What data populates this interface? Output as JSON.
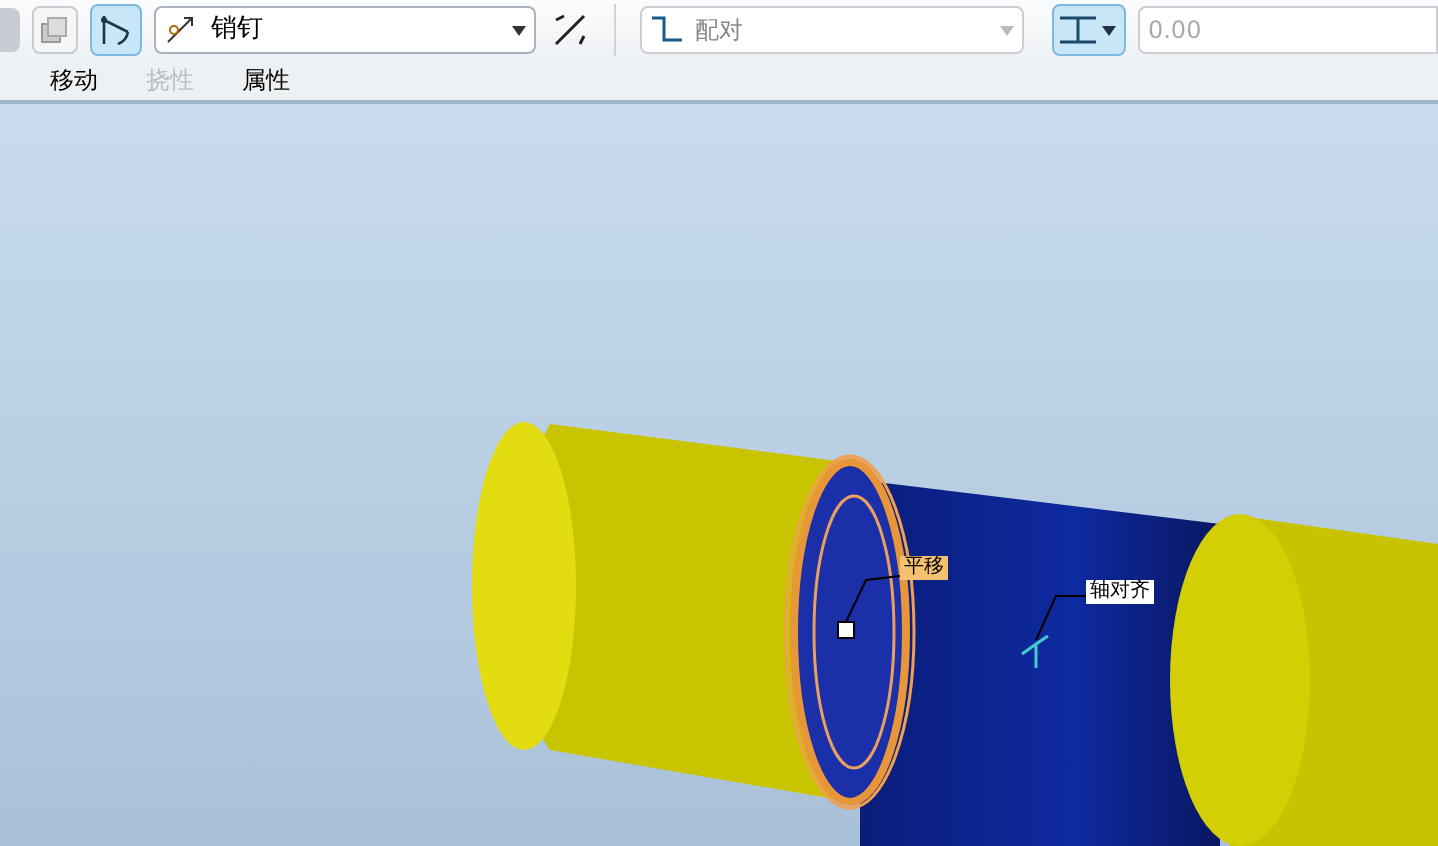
{
  "toolbar": {
    "constraint_type": {
      "value": "销钉"
    },
    "reference_type": {
      "value": "配对",
      "disabled": true
    },
    "offset": {
      "placeholder": "0.00"
    }
  },
  "tabs": [
    {
      "label": "移动",
      "disabled": false
    },
    {
      "label": "挠性",
      "disabled": true
    },
    {
      "label": "属性",
      "disabled": false
    }
  ],
  "viewport": {
    "labels": [
      {
        "text": "平移",
        "kind": "highlight"
      },
      {
        "text": "轴对齐",
        "kind": "plain"
      }
    ]
  }
}
